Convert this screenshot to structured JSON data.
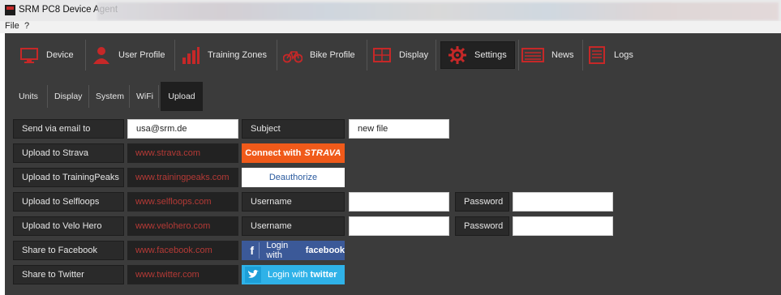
{
  "window": {
    "title": "SRM PC8 Device Agent"
  },
  "menu": {
    "file": "File",
    "help": "?"
  },
  "nav": {
    "items": [
      {
        "label": "Device",
        "icon": "monitor-icon"
      },
      {
        "label": "User Profile",
        "icon": "user-icon"
      },
      {
        "label": "Training Zones",
        "icon": "bar-chart-icon"
      },
      {
        "label": "Bike Profile",
        "icon": "bike-icon"
      },
      {
        "label": "Display",
        "icon": "display-icon"
      },
      {
        "label": "Settings",
        "icon": "gear-icon",
        "active": true
      },
      {
        "label": "News",
        "icon": "news-icon"
      },
      {
        "label": "Logs",
        "icon": "logs-icon"
      }
    ]
  },
  "subnav": {
    "items": [
      {
        "label": "Units"
      },
      {
        "label": "Display"
      },
      {
        "label": "System"
      },
      {
        "label": "WiFi"
      },
      {
        "label": "Upload",
        "active": true
      }
    ]
  },
  "upload": {
    "email_label": "Send via email to",
    "email_value": "usa@srm.de",
    "subject_label": "Subject",
    "subject_value": "new file",
    "strava_label": "Upload to Strava",
    "strava_url": "www.strava.com",
    "strava_button_prefix": "Connect with",
    "strava_button_brand": "STRAVA",
    "tp_label": "Upload to TrainingPeaks",
    "tp_url": "www.trainingpeaks.com",
    "tp_button": "Deauthorize",
    "selfloops_label": "Upload to Selfloops",
    "selfloops_url": "www.selfloops.com",
    "velohero_label": "Upload to Velo Hero",
    "velohero_url": "www.velohero.com",
    "username_label": "Username",
    "password_label": "Password",
    "facebook_label": "Share to Facebook",
    "facebook_url": "www.facebook.com",
    "facebook_button_prefix": "Login with",
    "facebook_button_brand": "facebook",
    "twitter_label": "Share to Twitter",
    "twitter_url": "www.twitter.com",
    "twitter_button_prefix": "Login with",
    "twitter_button_brand": "twitter"
  },
  "colors": {
    "accent_red": "#c62828",
    "app_background": "#3b3b3b",
    "strava": "#f05a1a",
    "facebook": "#3b5998",
    "twitter": "#2fb2e8"
  }
}
